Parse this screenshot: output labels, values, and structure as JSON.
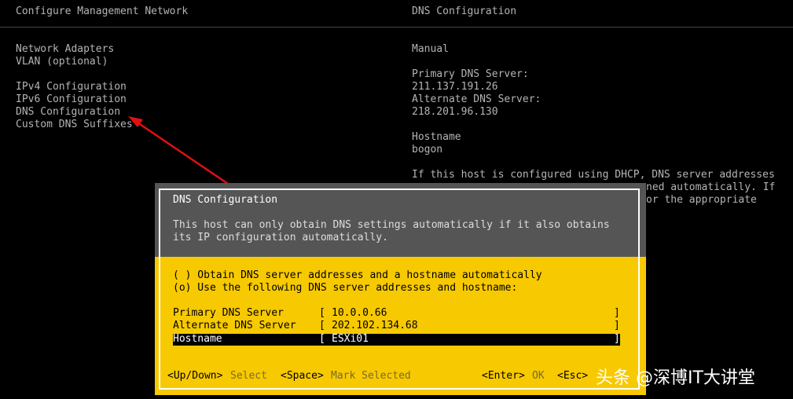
{
  "left": {
    "title": "Configure Management Network",
    "items": [
      "Network Adapters",
      "VLAN (optional)",
      "IPv4 Configuration",
      "IPv6 Configuration",
      "DNS Configuration",
      "Custom DNS Suffixes"
    ]
  },
  "right": {
    "title": "DNS Configuration",
    "mode": "Manual",
    "primary_label": "Primary DNS Server:",
    "primary": "211.137.191.26",
    "alternate_label": "Alternate DNS Server:",
    "alternate": "218.201.96.130",
    "hostname_label": "Hostname",
    "hostname": "bogon",
    "note1": "If this host is configured using DHCP, DNS server addresses",
    "note2": "ned automatically. If",
    "note3": "or the appropriate"
  },
  "dialog": {
    "title": "DNS Configuration",
    "desc1": "This host can only obtain DNS settings automatically if it also obtains",
    "desc2": "its IP configuration automatically.",
    "opt1": "( ) Obtain DNS server addresses and a hostname automatically",
    "opt2": "(o) Use the following DNS server addresses and hostname:",
    "fields": [
      {
        "label": "Primary DNS Server",
        "value": "10.0.0.66"
      },
      {
        "label": "Alternate DNS Server",
        "value": "202.102.134.68"
      },
      {
        "label": "Hostname",
        "value": "ESXi01"
      }
    ],
    "keys": [
      {
        "key": "<Up/Down>",
        "action": "Select"
      },
      {
        "key": "<Space>",
        "action": "Mark Selected"
      },
      {
        "key": "<Enter>",
        "action": "OK"
      },
      {
        "key": "<Esc>",
        "action": ""
      }
    ]
  },
  "watermark": "头条 @深博IT大讲堂"
}
